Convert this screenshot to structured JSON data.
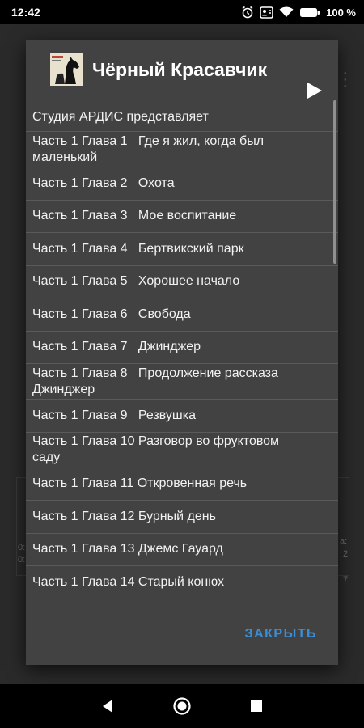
{
  "status_bar": {
    "time": "12:42",
    "battery": "100 %",
    "icons": [
      "alarm-icon",
      "contact-card-icon",
      "wifi-icon",
      "battery-icon"
    ]
  },
  "background": {
    "fragments": [
      "0:",
      "0:",
      "a:",
      "2",
      "7"
    ]
  },
  "dialog": {
    "title": "Чёрный Красавчик",
    "cover_icon": "horse-cover-icon",
    "items": [
      {
        "label": "Студия АРДИС представляет"
      },
      {
        "label": "Часть 1 Глава 1   Где я жил, когда был маленький"
      },
      {
        "label": "Часть 1 Глава 2   Охота"
      },
      {
        "label": "Часть 1 Глава 3   Мое воспитание"
      },
      {
        "label": "Часть 1 Глава 4   Бертвикский парк"
      },
      {
        "label": "Часть 1 Глава 5   Хорошее начало"
      },
      {
        "label": "Часть 1 Глава 6   Свобода"
      },
      {
        "label": "Часть 1 Глава 7   Джинджер"
      },
      {
        "label": "Часть 1 Глава 8   Продолжение рассказа Джинджер"
      },
      {
        "label": "Часть 1 Глава 9   Резвушка"
      },
      {
        "label": "Часть 1 Глава 10 Разговор во фруктовом саду"
      },
      {
        "label": "Часть 1 Глава 11 Откровенная речь"
      },
      {
        "label": "Часть 1 Глава 12 Бурный день"
      },
      {
        "label": "Часть 1 Глава 13 Джемс Гауард"
      },
      {
        "label": "Часть 1 Глава 14 Старый конюх"
      }
    ],
    "play_icon": "play-icon",
    "close_label": "ЗАКРЫТЬ"
  },
  "nav_bar": {
    "icons": [
      "back-icon",
      "home-icon",
      "recents-icon"
    ]
  },
  "colors": {
    "dialog_bg": "#424242",
    "accent": "#3b8fd6",
    "divider": "#5a5a5a"
  }
}
